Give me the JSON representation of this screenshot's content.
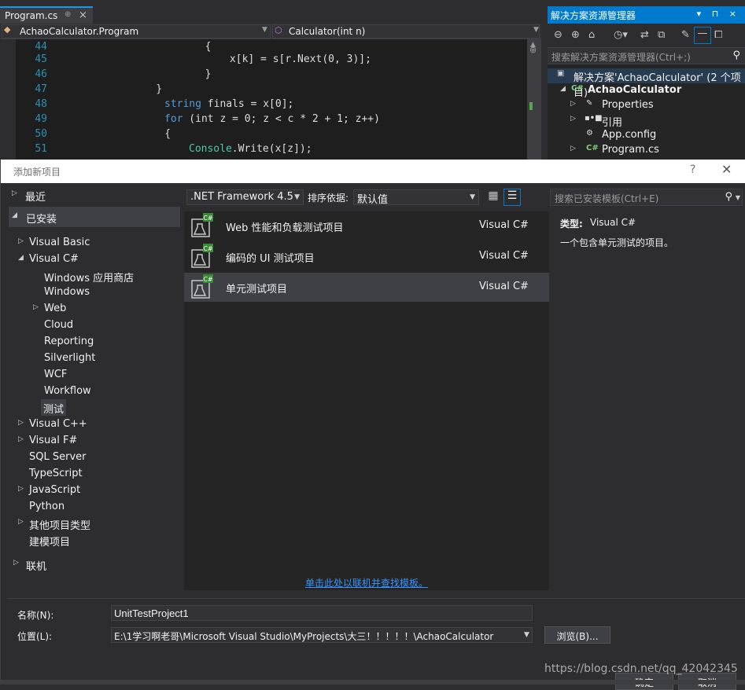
{
  "editor": {
    "tab_label": "Program.cs",
    "tab_pin": "⊕",
    "tab_close": "×",
    "nav_left": "AchaoCalculator.Program",
    "nav_right": "Calculator(int n)",
    "lines": [
      {
        "num": "44",
        "text": "        {"
      },
      {
        "num": "45",
        "text": "            x[k] = s[r.Next(0, 3)];"
      },
      {
        "num": "46",
        "text": "        }"
      },
      {
        "num": "47",
        "text": "    }"
      },
      {
        "num": "48",
        "kw": "string",
        "text": " finals = x[0];"
      },
      {
        "num": "49",
        "kw": "for",
        "text": " (int z = 0; z < c * 2 + 1; z++)"
      },
      {
        "num": "50",
        "text": "    {"
      },
      {
        "num": "51",
        "cls": "Console",
        "text": ".Write(x[z]);"
      }
    ]
  },
  "solution_explorer": {
    "title": "解决方案资源管理器",
    "search_placeholder": "搜索解决方案资源管理器(Ctrl+;)",
    "solution_label": "解决方案'AchaoCalculator' (2 个项目)",
    "project": "AchaoCalculator",
    "items": [
      "Properties",
      "引用",
      "App.config",
      "Program.cs"
    ]
  },
  "dialog": {
    "title": "添加新项目",
    "help": "?",
    "close": "✕",
    "tree": {
      "recent": "最近",
      "installed": "已安装",
      "visual_basic": "Visual Basic",
      "visual_csharp": "Visual C#",
      "csharp_children": [
        "Windows 应用商店",
        "Windows",
        "Web",
        "Cloud",
        "Reporting",
        "Silverlight",
        "WCF",
        "Workflow",
        "测试"
      ],
      "visual_cpp": "Visual C++",
      "visual_fsharp": "Visual F#",
      "sql_server": "SQL Server",
      "typescript": "TypeScript",
      "javascript": "JavaScript",
      "python": "Python",
      "other_types": "其他项目类型",
      "modeling": "建模项目",
      "online": "联机"
    },
    "framework": ".NET Framework 4.5",
    "sort_label": "排序依据:",
    "sort_value": "默认值",
    "templates": [
      {
        "name": "Web 性能和负载测试项目",
        "lang": "Visual C#"
      },
      {
        "name": "编码的 UI 测试项目",
        "lang": "Visual C#"
      },
      {
        "name": "单元测试项目",
        "lang": "Visual C#"
      }
    ],
    "online_link": "单击此处以联机并查找模板。",
    "search_placeholder": "搜索已安装模板(Ctrl+E)",
    "type_label": "类型:",
    "type_value": "Visual C#",
    "description": "一个包含单元测试的项目。",
    "name_label": "名称(N):",
    "name_value": "UnitTestProject1",
    "location_label": "位置(L):",
    "location_value": "E:\\1学习啊老哥\\Microsoft Visual Studio\\MyProjects\\大三！！！！！\\AchaoCalculator",
    "browse": "浏览(B)...",
    "ok": "确定",
    "cancel": "取消"
  },
  "watermark": "https://blog.csdn.net/qq_42042345",
  "colors": {
    "accent": "#007acc",
    "background": "#2d2d30",
    "keyword": "#569cd6",
    "type": "#4ec9b0",
    "line_number": "#2b91af"
  }
}
